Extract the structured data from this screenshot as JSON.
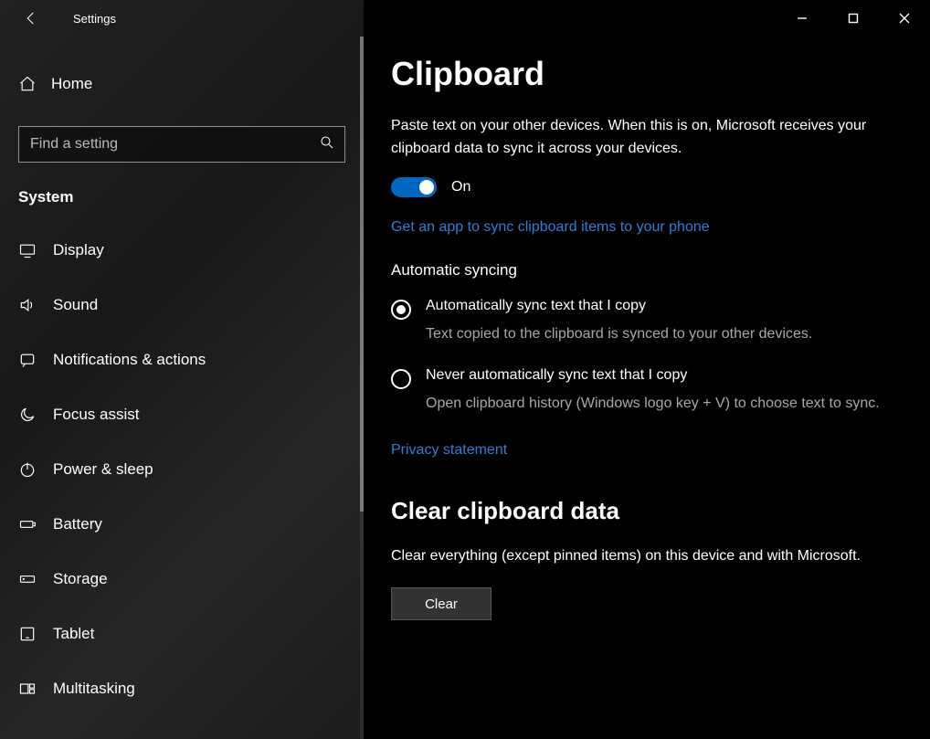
{
  "window": {
    "title": "Settings"
  },
  "sidebar": {
    "home_label": "Home",
    "search_placeholder": "Find a setting",
    "category": "System",
    "items": [
      {
        "label": "Display"
      },
      {
        "label": "Sound"
      },
      {
        "label": "Notifications & actions"
      },
      {
        "label": "Focus assist"
      },
      {
        "label": "Power & sleep"
      },
      {
        "label": "Battery"
      },
      {
        "label": "Storage"
      },
      {
        "label": "Tablet"
      },
      {
        "label": "Multitasking"
      }
    ]
  },
  "main": {
    "page_title": "Clipboard",
    "sync_desc": "Paste text on your other devices. When this is on, Microsoft receives your clipboard data to sync it across your devices.",
    "toggle_state": "On",
    "link_app": "Get an app to sync clipboard items to your phone",
    "auto_sync_heading": "Automatic syncing",
    "radios": [
      {
        "title": "Automatically sync text that I copy",
        "desc": "Text copied to the clipboard is synced to your other devices.",
        "selected": true
      },
      {
        "title": "Never automatically sync text that I copy",
        "desc": "Open clipboard history (Windows logo key + V) to choose text to sync.",
        "selected": false
      }
    ],
    "link_privacy": "Privacy statement",
    "clear_heading": "Clear clipboard data",
    "clear_desc": "Clear everything (except pinned items) on this device and with Microsoft.",
    "clear_button": "Clear"
  }
}
